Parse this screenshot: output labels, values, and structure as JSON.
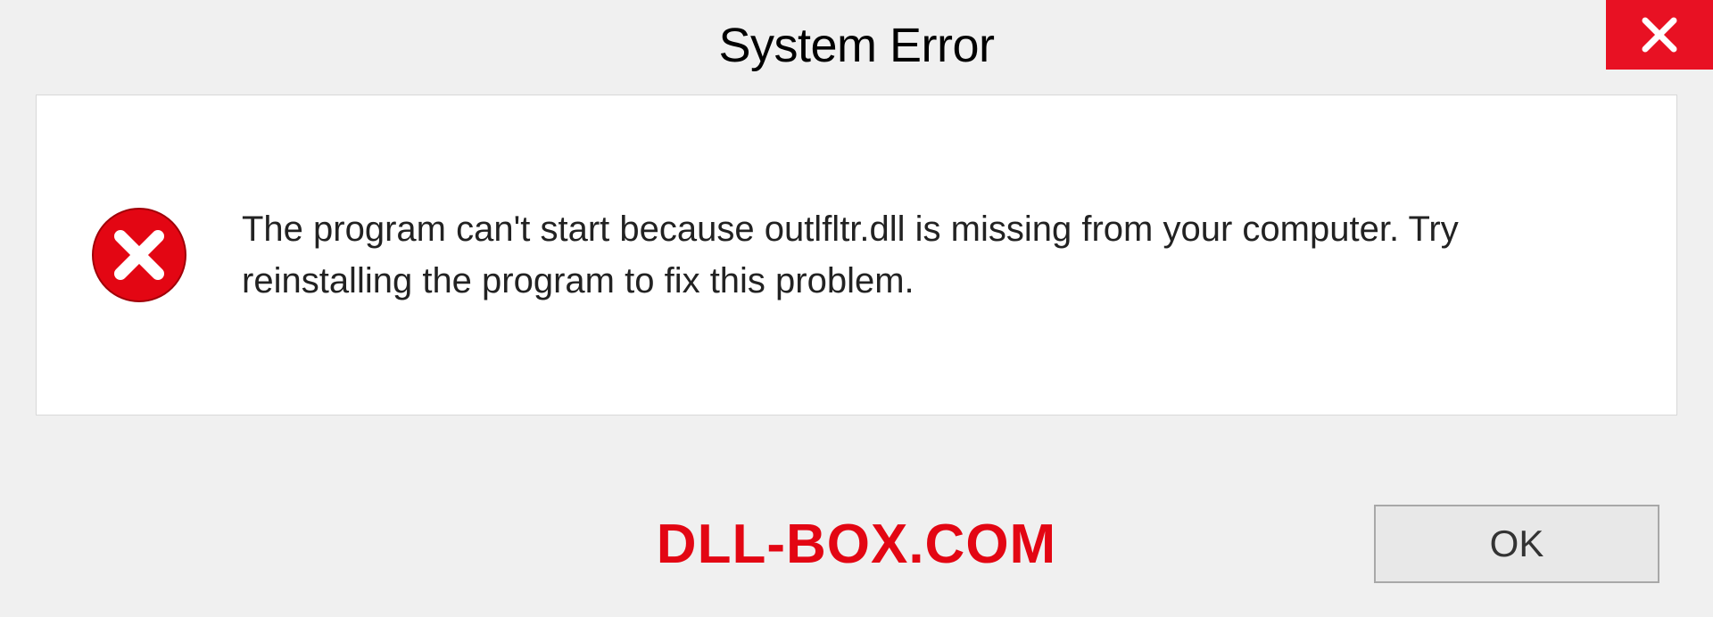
{
  "dialog": {
    "title": "System Error",
    "message": "The program can't start because outlfltr.dll is missing from your computer. Try reinstalling the program to fix this problem.",
    "ok_label": "OK"
  },
  "watermark": "DLL-BOX.COM",
  "colors": {
    "close_bg": "#e81123",
    "error_icon": "#e30613",
    "watermark": "#e30613"
  }
}
